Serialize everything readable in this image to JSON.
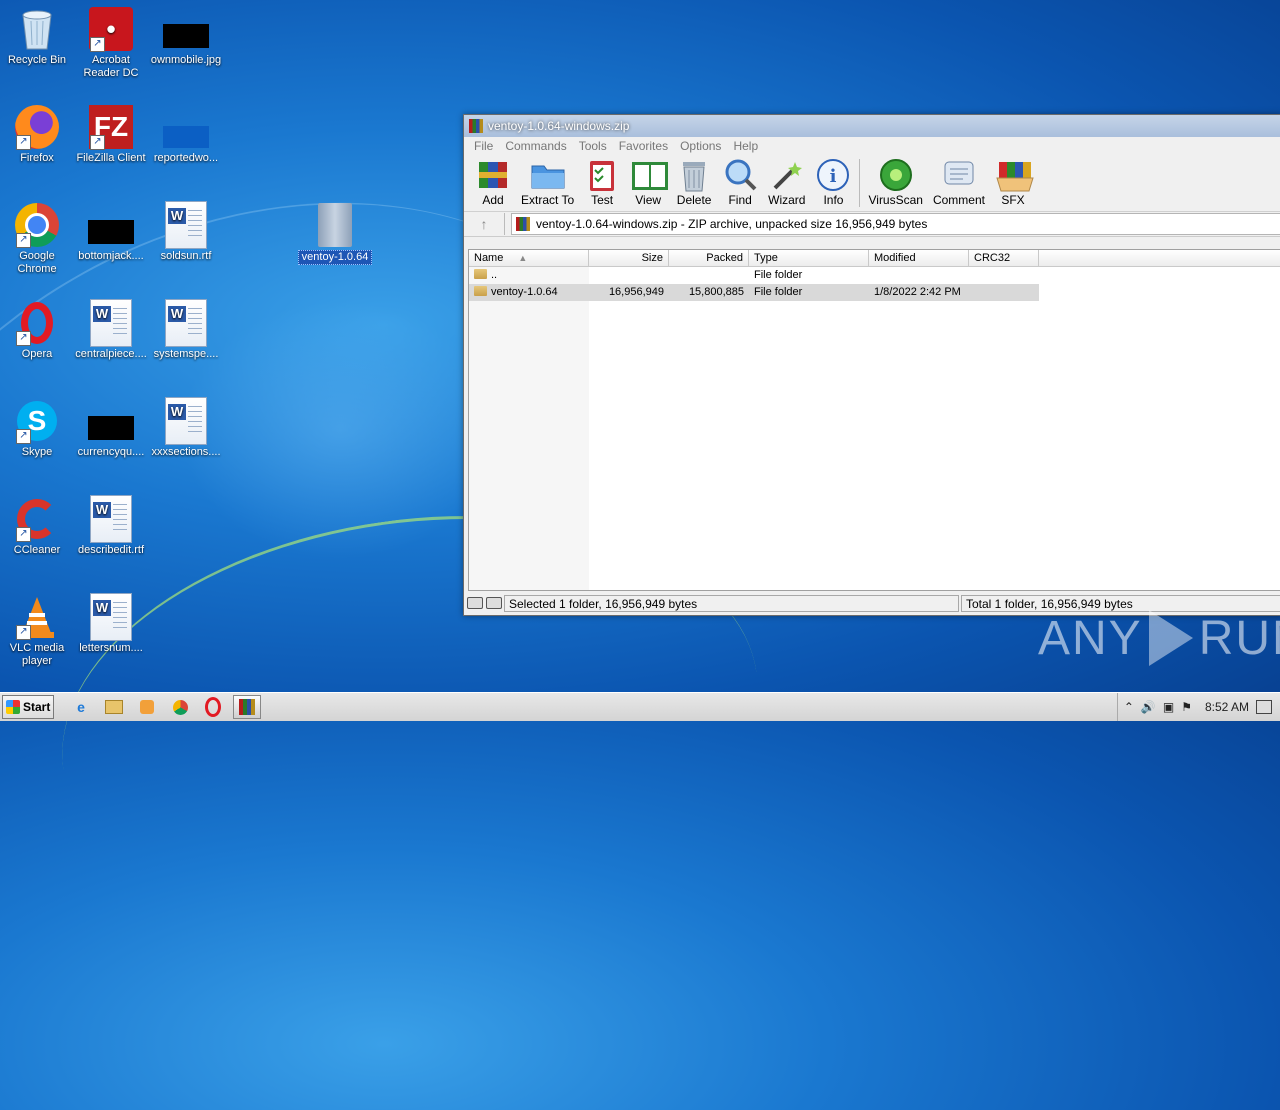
{
  "desktop": {
    "icons": [
      {
        "label": "Recycle Bin",
        "icon": "recycle-bin-icon"
      },
      {
        "label": "Acrobat Reader DC",
        "icon": "acrobat-icon"
      },
      {
        "label": "ownmobile.jpg",
        "icon": "image-file-icon"
      },
      {
        "label": "Firefox",
        "icon": "firefox-icon"
      },
      {
        "label": "FileZilla Client",
        "icon": "filezilla-icon"
      },
      {
        "label": "reportedwo...",
        "icon": "file-icon"
      },
      {
        "label": "Google Chrome",
        "icon": "chrome-icon"
      },
      {
        "label": "bottomjack....",
        "icon": "file-icon"
      },
      {
        "label": "soldsun.rtf",
        "icon": "word-doc-icon"
      },
      {
        "label": "ventoy-1.0.64",
        "icon": "folder-icon"
      },
      {
        "label": "Opera",
        "icon": "opera-icon"
      },
      {
        "label": "centralpiece....",
        "icon": "word-doc-icon"
      },
      {
        "label": "systemspe....",
        "icon": "word-doc-icon"
      },
      {
        "label": "Skype",
        "icon": "skype-icon"
      },
      {
        "label": "currencyqu....",
        "icon": "file-icon"
      },
      {
        "label": "xxxsections....",
        "icon": "word-doc-icon"
      },
      {
        "label": "CCleaner",
        "icon": "ccleaner-icon"
      },
      {
        "label": "describedit.rtf",
        "icon": "word-doc-icon"
      },
      {
        "label": "VLC media player",
        "icon": "vlc-icon"
      },
      {
        "label": "lettersnum....",
        "icon": "word-doc-icon"
      }
    ]
  },
  "window": {
    "title": "ventoy-1.0.64-windows.zip",
    "menu": [
      "File",
      "Commands",
      "Tools",
      "Favorites",
      "Options",
      "Help"
    ],
    "toolbar": [
      "Add",
      "Extract To",
      "Test",
      "View",
      "Delete",
      "Find",
      "Wizard",
      "Info",
      "VirusScan",
      "Comment",
      "SFX"
    ],
    "address": "ventoy-1.0.64-windows.zip - ZIP archive, unpacked size 16,956,949 bytes",
    "columns": [
      "Name",
      "Size",
      "Packed",
      "Type",
      "Modified",
      "CRC32"
    ],
    "rows": [
      {
        "name": "..",
        "size": "",
        "packed": "",
        "type": "File folder",
        "modified": ""
      },
      {
        "name": "ventoy-1.0.64",
        "size": "16,956,949",
        "packed": "15,800,885",
        "type": "File folder",
        "modified": "1/8/2022 2:42 PM"
      }
    ],
    "status_left": "Selected 1 folder, 16,956,949 bytes",
    "status_right": "Total 1 folder, 16,956,949 bytes"
  },
  "taskbar": {
    "start_label": "Start",
    "clock": "8:52 AM"
  },
  "watermark": {
    "left": "ANY",
    "right": "RUN"
  }
}
